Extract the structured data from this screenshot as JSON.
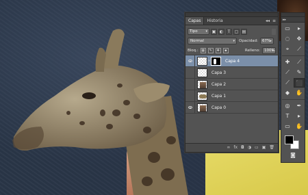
{
  "layers_panel": {
    "tabs": [
      "Capas",
      "Historia"
    ],
    "collapse_glyph": "◂◂",
    "menu_glyph": "≡",
    "filter": {
      "value": "Tipo",
      "icons": [
        "image-filter-icon",
        "adjustment-filter-icon",
        "type-filter-icon",
        "shape-filter-icon",
        "smart-object-filter-icon"
      ]
    },
    "blend_mode": "Normal",
    "opacity_label": "Opacidad:",
    "opacity_value": "67%",
    "lock_label": "Bloq.:",
    "fill_label": "Relleno:",
    "fill_value": "100%",
    "layers": [
      {
        "name": "Capa 4",
        "visible": true,
        "selected": true,
        "has_mask": true,
        "thumb": "transparent"
      },
      {
        "name": "Capa 3",
        "visible": false,
        "selected": false,
        "has_mask": false,
        "thumb": "transparent"
      },
      {
        "name": "Capa 2",
        "visible": false,
        "selected": false,
        "has_mask": false,
        "thumb": "photo"
      },
      {
        "name": "Capa 1",
        "visible": false,
        "selected": false,
        "has_mask": false,
        "thumb": "giraffe"
      },
      {
        "name": "Capa 0",
        "visible": true,
        "selected": false,
        "has_mask": false,
        "thumb": "photo"
      }
    ],
    "bottom_icons": [
      "link-layers-icon",
      "fx-icon",
      "add-mask-icon",
      "adjustment-layer-icon",
      "new-group-icon",
      "new-layer-icon",
      "trash-icon"
    ],
    "bottom_glyphs": [
      "∞",
      "fx",
      "◘",
      "◑",
      "▭",
      "▣",
      "🗑"
    ]
  },
  "tools_panel": {
    "header_glyph": "▸▸",
    "tools": [
      "▭",
      "▸",
      "◌",
      "✥",
      "⌖",
      "⟋",
      "✚",
      "⟋",
      "⟋",
      "✎",
      "⟋",
      "⬛",
      "◆",
      "✋",
      "◎",
      "✒",
      "T",
      "▸",
      "▭",
      "✋",
      "🔍"
    ],
    "foreground_color": "#000000",
    "background_color": "#ffffff"
  },
  "colors": {
    "selected_layer": "#7b8fa9",
    "panel_bg": "#535353",
    "canvas_bg": "#2a3648"
  }
}
